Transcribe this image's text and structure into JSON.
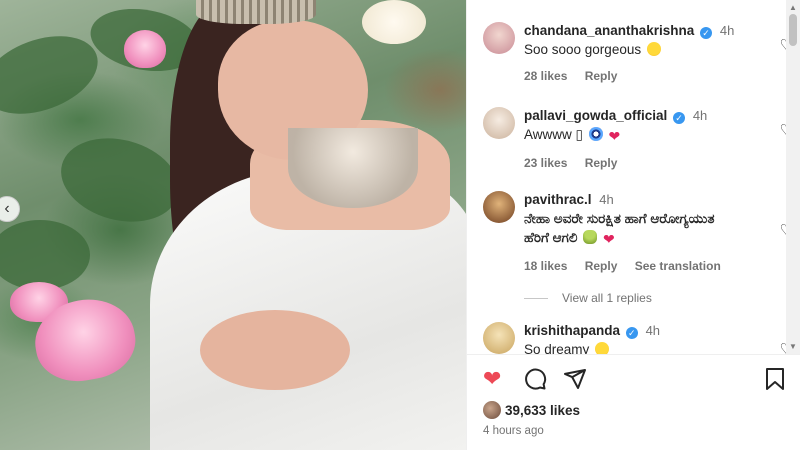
{
  "post": {
    "carousel_prev": "‹"
  },
  "comments": [
    {
      "username": "chandana_ananthakrishna",
      "verified": true,
      "time": "4h",
      "text": "Soo sooo gorgeous",
      "emojis": [
        "star-struck"
      ],
      "likes": "28 likes",
      "reply": "Reply",
      "avatar_color": "#d9a0a8"
    },
    {
      "username": "pallavi_gowda_official",
      "verified": true,
      "time": "4h",
      "text": "Awwww ▯",
      "emojis": [
        "nazar-amulet",
        "red-heart"
      ],
      "likes": "23 likes",
      "reply": "Reply",
      "avatar_color": "#e8d7c8"
    },
    {
      "username": "pavithrac.l",
      "verified": false,
      "time": "4h",
      "text": "ನೇಹಾ ಅವರೇ ಸುರಕ್ಷಿತ ಹಾಗೆ ಆರೋಗ್ಯಯುತ ಹೆರಿಗೆ ಆಗಲಿ",
      "emojis": [
        "potted-plant",
        "red-heart"
      ],
      "likes": "18 likes",
      "reply": "Reply",
      "translation": "See translation",
      "avatar_color": "#a86a3a"
    },
    {
      "username": "krishithapanda",
      "verified": true,
      "time": "4h",
      "text": "So dreamy",
      "emojis": [
        "star-struck"
      ],
      "avatar_color": "#e6cfa0"
    }
  ],
  "view_replies": "View all 1 replies",
  "actions": {
    "likes": "39,633 likes",
    "time": "4 hours ago"
  },
  "colors": {
    "like_active": "#ed4956",
    "verified": "#3897f0",
    "muted_text": "#737373"
  }
}
